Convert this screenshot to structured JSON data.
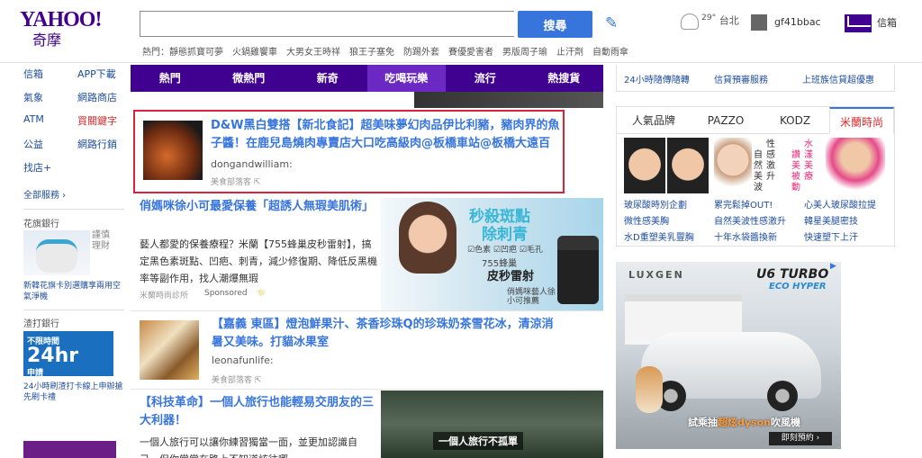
{
  "header": {
    "logo_line1": "YAHOO!",
    "logo_line2": "奇摩",
    "search_value": "",
    "search_button": "搜尋",
    "hot_label": "熱門：",
    "hot_items": [
      "靜態抓寶可夢",
      "火鍋雞饗車",
      "大男女王時祥",
      "狼王子塞免",
      "防踢外套",
      "賽優愛害者",
      "男版周子瑜",
      "止汗劑",
      "自動雨傘"
    ],
    "weather_temp": "29°",
    "weather_city": "台北",
    "username": "gf41bbac",
    "mail_label": "信箱"
  },
  "sidebar": {
    "col1": [
      "信箱",
      "氣象",
      "ATM",
      "公益",
      "找店+"
    ],
    "col2": [
      "APP下載",
      "網路商店",
      "買關鍵字",
      "網路行銷"
    ],
    "all_services": "全部服務 ›",
    "section1_title": "花旗銀行",
    "section1_vertical": "謹慎理財",
    "section1_link": "新韓花旗卡別選購享兩用空氣淨機",
    "section2_title": "渣打銀行",
    "section2_promo_top": "不限時間",
    "section2_promo_big": "24hr",
    "section2_promo_sub": "申請",
    "section2_link": "24小時刷渣打卡線上申辦搶先刷卡禮"
  },
  "tabs": [
    "熱門",
    "微熱門",
    "新奇",
    "吃喝玩樂",
    "流行",
    "熱搜貨"
  ],
  "active_tab": "吃喝玩樂",
  "feed": {
    "item1": {
      "title": "D&W黑白雙搭【新北食記】超美味夢幻肉品伊比利豬，豬肉界的魚子醬！在鹿兒島燒肉專賣店大口吃高級肉@板橋車站@板橋大遠百",
      "source": "dongandwilliam:",
      "meta": "美食部落客"
    },
    "item2": {
      "title": "俏媽咪徐小可最愛保養「超誘人無瑕美肌術」",
      "body": "藝人都愛的保養療程？米蘭【755蜂巢皮秒雷射】，搞定黑色素斑點、凹疤、刺青，減少修復期、降低反黑機率等副作用，找人潮爆無瑕",
      "source": "米蘭時尚診所",
      "sponsored": "Sponsored",
      "ad_big": "秒殺斑點",
      "ad_big2": "除刺青",
      "ad_checks": "☑色素 ☑凹疤 ☑毛孔",
      "ad_prod1": "755蜂巢",
      "ad_prod2": "皮秒雷射",
      "ad_caption": "俏媽咪藝人徐小可推薦"
    },
    "item3": {
      "title": "【嘉義 東區】燈泡鮮果汁、茶香珍珠Q的珍珠奶茶雪花冰，清涼消暑又美味。打貓冰果室",
      "source": "leonafunlife:",
      "meta": "美食部落客"
    },
    "item4": {
      "title": "【科技革命】一個人旅行也能輕易交朋友的三大利器！",
      "body": "一個人旅行可以讓你練習獨當一面，並更加認識自己，但你常常在路上不知道該往哪",
      "photo_label": "一個人旅行不孤單"
    }
  },
  "right": {
    "top_links": [
      "24小時隨傳隨轉",
      "信貸預審服務",
      "上班族信貸超優惠"
    ],
    "brand_tabs": [
      "人氣品牌",
      "PAZZO",
      "KODZ",
      "米蘭時尚"
    ],
    "brand_active": "米蘭時尚",
    "brand_vert1": "性感激升",
    "brand_vert2": "自然美波",
    "brand_vert3": "水漾美療",
    "brand_vert4": "讚美被動",
    "brand_links": [
      "玻尿酸時別企劃",
      "微性感美胸",
      "水D重塑美乳豐胸",
      "累完鬆掉OUT!",
      "自然美波性感激升",
      "十年水袋醬換新",
      "心美人玻尿酸拉提",
      "韓星美腿密技",
      "快速塑下上汗"
    ],
    "car_brand": "LUXGEN",
    "car_model": "U6 TURBO",
    "car_sub": "ECO HYPER",
    "car_caption_pre": "試乘抽",
    "car_caption_hl": "超炫dyson",
    "car_caption_post": "吹風機",
    "car_cta": "即刻預約 ›"
  }
}
